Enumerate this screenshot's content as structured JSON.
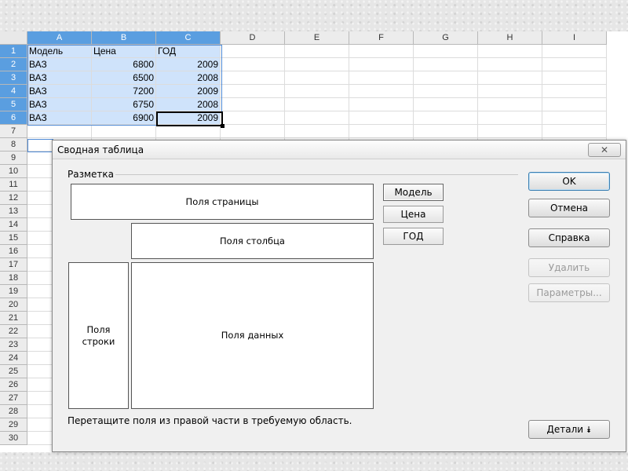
{
  "sheet": {
    "columns": [
      "A",
      "B",
      "C",
      "D",
      "E",
      "F",
      "G",
      "H",
      "I"
    ],
    "rows": [
      "1",
      "2",
      "3",
      "4",
      "5",
      "6",
      "7",
      "8",
      "9",
      "10",
      "11",
      "12",
      "13",
      "14",
      "15",
      "16",
      "17",
      "18",
      "19",
      "20",
      "21",
      "22",
      "23",
      "24",
      "25",
      "26",
      "27",
      "28",
      "29",
      "30"
    ],
    "cells": [
      [
        "Модель",
        "Цена",
        "ГОД"
      ],
      [
        "ВАЗ",
        "6800",
        "2009"
      ],
      [
        "ВАЗ",
        "6500",
        "2008"
      ],
      [
        "ВАЗ",
        "7200",
        "2009"
      ],
      [
        "ВАЗ",
        "6750",
        "2008"
      ],
      [
        "ВАЗ",
        "6900",
        "2009"
      ]
    ],
    "selection_color": "#cfe3fb",
    "header_selected_color": "#5a9ee0"
  },
  "dialog": {
    "title": "Сводная таблица",
    "close_icon": "✕",
    "layout_legend": "Разметка",
    "page_fields": "Поля страницы",
    "column_fields": "Поля столбца",
    "row_fields_line1": "Поля",
    "row_fields_line2": "строки",
    "data_fields": "Поля данных",
    "field_buttons": [
      "Модель",
      "Цена",
      "ГОД"
    ],
    "ok": "OK",
    "cancel": "Отмена",
    "help": "Справка",
    "delete": "Удалить",
    "options": "Параметры...",
    "details": "Детали",
    "details_icon": "⯯",
    "hint": "Перетащите поля из правой части в требуемую область."
  }
}
